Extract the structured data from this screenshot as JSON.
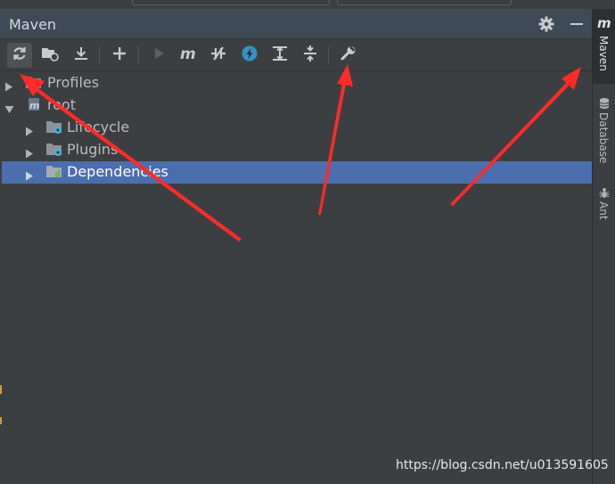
{
  "panel": {
    "title": "Maven",
    "gear_icon": "gear-icon",
    "minimize_icon": "minimize-icon"
  },
  "toolbar": {
    "buttons": [
      {
        "name": "reload-all-maven-projects",
        "icon": "refresh-icon",
        "active": true
      },
      {
        "name": "generate-sources",
        "icon": "folder-refresh-icon"
      },
      {
        "name": "download-sources",
        "icon": "download-icon"
      },
      {
        "name": "add-maven-project",
        "icon": "plus-icon"
      },
      {
        "name": "run-maven-build",
        "icon": "play-icon",
        "disabled": true
      },
      {
        "name": "execute-maven-goal",
        "icon": "maven-m-icon"
      },
      {
        "name": "toggle-offline-mode",
        "icon": "offline-icon"
      },
      {
        "name": "toggle-skip-tests",
        "icon": "lightning-icon"
      },
      {
        "name": "show-dependencies",
        "icon": "expand-icon"
      },
      {
        "name": "collapse-all",
        "icon": "collapse-icon"
      },
      {
        "name": "maven-settings",
        "icon": "wrench-icon"
      }
    ]
  },
  "tree": {
    "items": [
      {
        "label": "Profiles",
        "icon": "profiles-folder-icon",
        "expanded": false,
        "level": 0
      },
      {
        "label": "root",
        "icon": "maven-module-icon",
        "expanded": true,
        "level": 0
      },
      {
        "label": "Lifecycle",
        "icon": "lifecycle-folder-icon",
        "expanded": false,
        "level": 1
      },
      {
        "label": "Plugins",
        "icon": "plugins-folder-icon",
        "expanded": false,
        "level": 1
      },
      {
        "label": "Dependencies",
        "icon": "dependencies-folder-icon",
        "expanded": false,
        "level": 1,
        "selected": true
      }
    ]
  },
  "sidebar": {
    "tabs": [
      {
        "label": "Maven",
        "icon": "maven-m-icon",
        "active": true
      },
      {
        "label": "Database",
        "icon": "database-icon"
      },
      {
        "label": "Ant",
        "icon": "ant-icon"
      }
    ]
  },
  "watermark": "https://blog.csdn.net/u013591605",
  "colors": {
    "panel_bg": "#3c3f41",
    "header_bg": "#3f4a57",
    "selection": "#4b6eaf",
    "annotation_arrow": "#ff2a2a"
  }
}
